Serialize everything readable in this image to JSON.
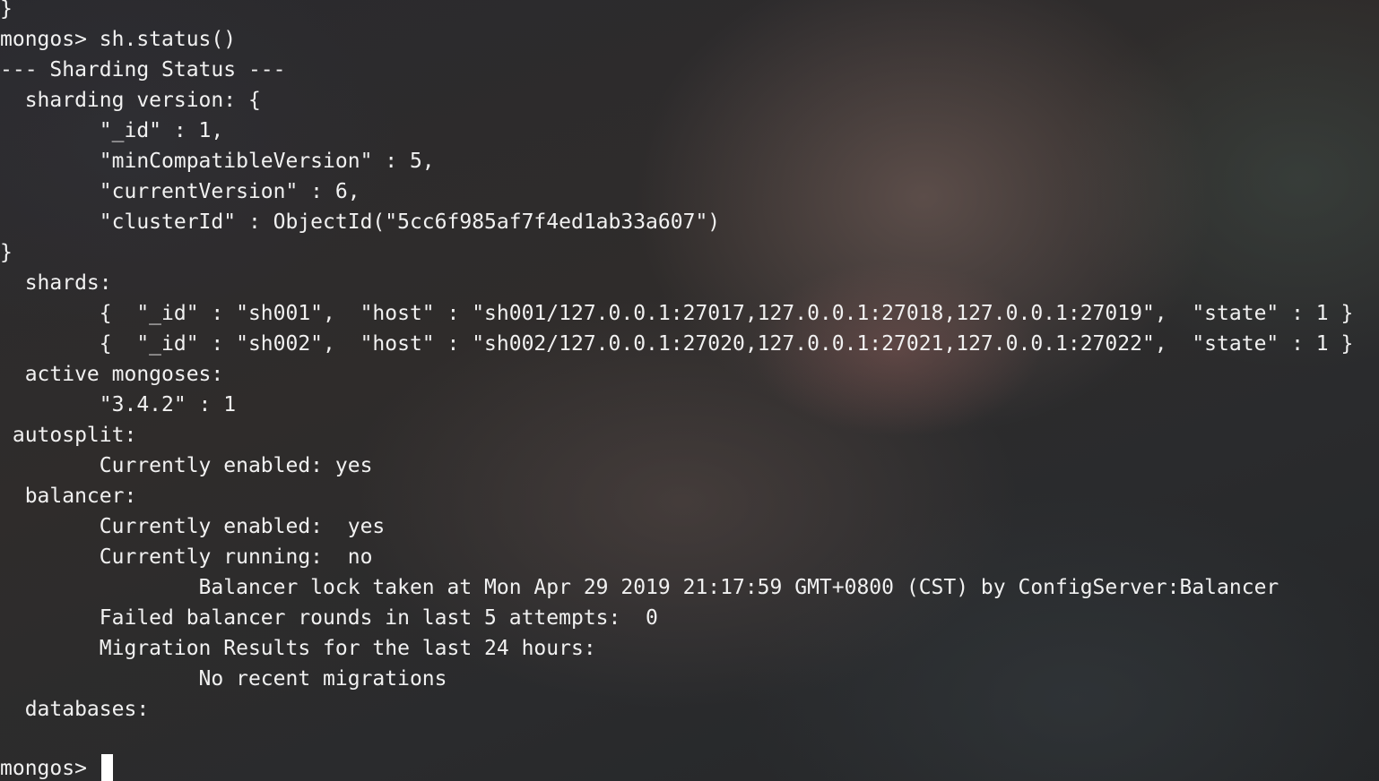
{
  "terminal": {
    "lines": [
      "}",
      "mongos> sh.status()",
      "--- Sharding Status ---",
      "  sharding version: {",
      "\t\"_id\" : 1,",
      "\t\"minCompatibleVersion\" : 5,",
      "\t\"currentVersion\" : 6,",
      "\t\"clusterId\" : ObjectId(\"5cc6f985af7f4ed1ab33a607\")",
      "}",
      "  shards:",
      "\t{  \"_id\" : \"sh001\",  \"host\" : \"sh001/127.0.0.1:27017,127.0.0.1:27018,127.0.0.1:27019\",  \"state\" : 1 }",
      "\t{  \"_id\" : \"sh002\",  \"host\" : \"sh002/127.0.0.1:27020,127.0.0.1:27021,127.0.0.1:27022\",  \"state\" : 1 }",
      "  active mongoses:",
      "\t\"3.4.2\" : 1",
      " autosplit:",
      "\tCurrently enabled: yes",
      "  balancer:",
      "\tCurrently enabled:  yes",
      "\tCurrently running:  no",
      "\t\tBalancer lock taken at Mon Apr 29 2019 21:17:59 GMT+0800 (CST) by ConfigServer:Balancer",
      "\tFailed balancer rounds in last 5 attempts:  0",
      "\tMigration Results for the last 24 hours: ",
      "\t\tNo recent migrations",
      "  databases:",
      ""
    ],
    "prompt": "mongos> ",
    "colors": {
      "text": "#f1f1f1",
      "cursor": "#ffffff"
    }
  }
}
